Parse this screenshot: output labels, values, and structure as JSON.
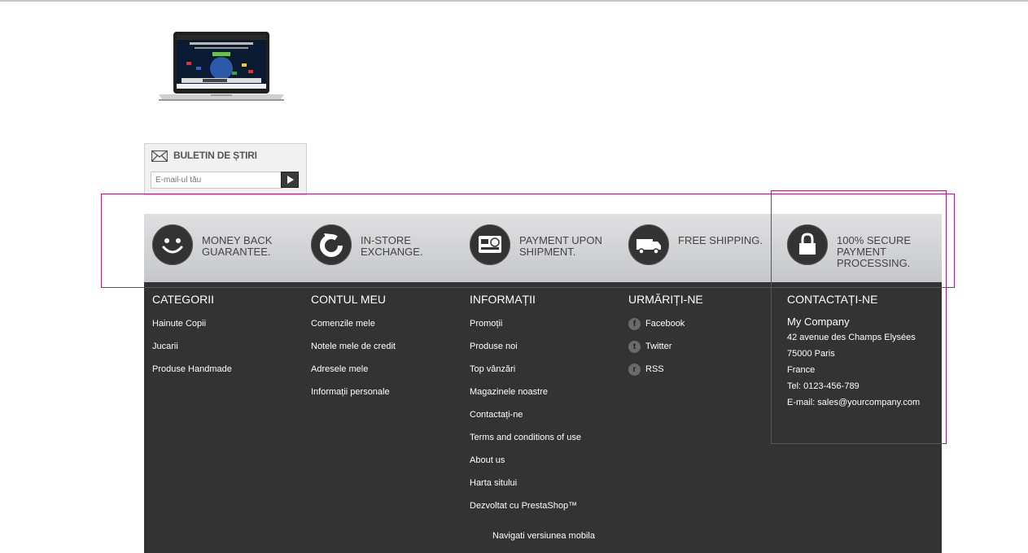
{
  "newsletter": {
    "title": "BULETIN DE ȘTIRI",
    "placeholder": "E-mail-ul tău",
    "icon": "envelope-icon",
    "submit_icon": "play-arrow-icon"
  },
  "reassurance": [
    {
      "text": "Money back\nguarantee.",
      "icon": "smiley-icon"
    },
    {
      "text": "In-store\nexchange.",
      "icon": "refresh-icon"
    },
    {
      "text": "Payment upon\nshipment.",
      "icon": "card-icon"
    },
    {
      "text": "Free Shipping.",
      "icon": "truck-icon"
    },
    {
      "text": "100% secure\npayment\nprocessing.",
      "icon": "lock-icon"
    }
  ],
  "footer": {
    "categories": {
      "title": "CATEGORII",
      "items": [
        "Hainute Copii",
        "Jucarii",
        "Produse Handmade"
      ]
    },
    "account": {
      "title": "CONTUL MEU",
      "items": [
        "Comenzile mele",
        "Notele mele de credit",
        "Adresele mele",
        "Informații personale"
      ]
    },
    "info": {
      "title": "INFORMAȚII",
      "items": [
        "Promoții",
        "Produse noi",
        "Top vânzări",
        "Magazinele noastre",
        "Contactați-ne",
        "Terms and conditions of use",
        "About us",
        "Harta sitului",
        "Dezvoltat cu PrestaShop™"
      ]
    },
    "follow": {
      "title": "URMĂRIȚI-NE",
      "items": [
        {
          "label": "Facebook",
          "glyph": "f",
          "icon": "facebook-icon"
        },
        {
          "label": "Twitter",
          "glyph": "t",
          "icon": "twitter-icon"
        },
        {
          "label": "RSS",
          "glyph": "r",
          "icon": "rss-icon"
        }
      ]
    },
    "contact": {
      "title": "CONTACTAȚI-NE",
      "company": "My Company",
      "lines": [
        "42 avenue des Champs Elysées",
        "75000 Paris",
        "France",
        "Tel: 0123-456-789",
        "E-mail: sales@yourcompany.com"
      ]
    },
    "mobile_link": "Navigati versiunea mobila"
  },
  "colors": {
    "footer_bg": "#333333",
    "bar_top": "#e0e0e2",
    "bar_bottom": "#c6c7ca",
    "annotation": "#c2187a"
  }
}
